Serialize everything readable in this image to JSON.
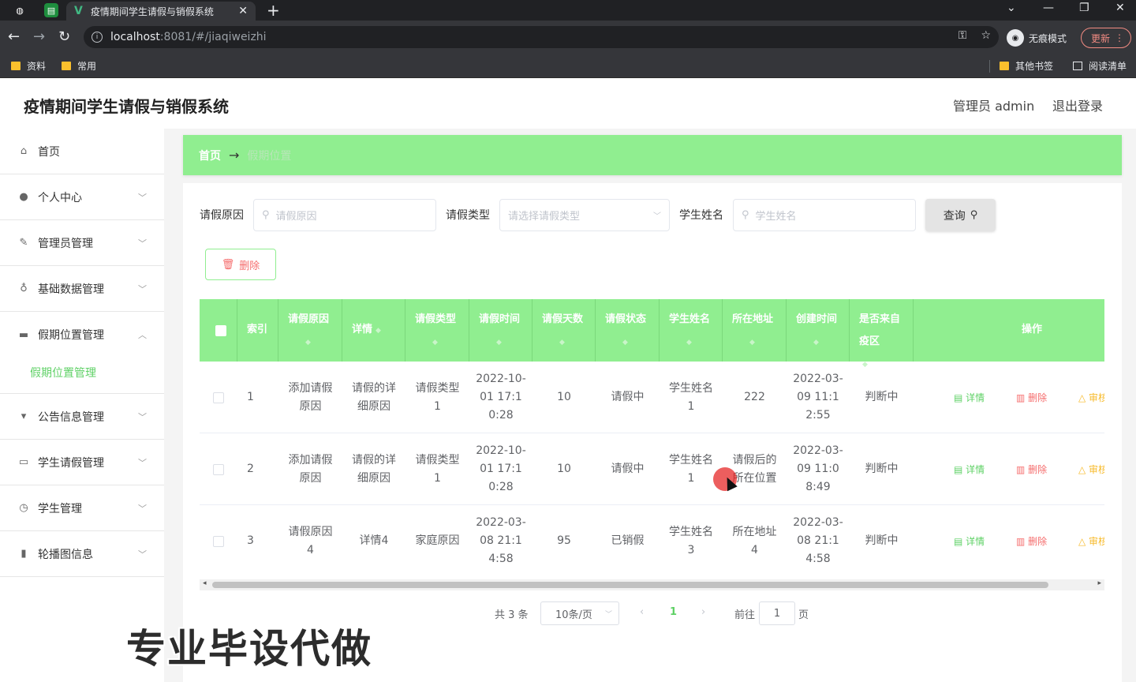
{
  "browser": {
    "tab_title": "疫情期间学生请假与销假系统",
    "url_host": "localhost",
    "url_path": ":8081/#/jiaqiweizhi",
    "incognito_label": "无痕模式",
    "update_label": "更新",
    "bookmarks": [
      "资料",
      "常用"
    ],
    "other_bookmarks": "其他书签",
    "reading_list": "阅读清单"
  },
  "header": {
    "title": "疫情期间学生请假与销假系统",
    "user": "管理员 admin",
    "logout": "退出登录"
  },
  "sidebar": {
    "items": [
      {
        "label": "首页",
        "icon": "home-icon"
      },
      {
        "label": "个人中心",
        "icon": "user-icon"
      },
      {
        "label": "管理员管理",
        "icon": "edit-icon"
      },
      {
        "label": "基础数据管理",
        "icon": "microphone-icon"
      },
      {
        "label": "假期位置管理",
        "icon": "chat-icon"
      },
      {
        "label": "公告信息管理",
        "icon": "notice-icon"
      },
      {
        "label": "学生请假管理",
        "icon": "message-icon"
      },
      {
        "label": "学生管理",
        "icon": "clock-icon"
      },
      {
        "label": "轮播图信息",
        "icon": "chart-icon"
      }
    ],
    "active_sub": "假期位置管理"
  },
  "breadcrumb": {
    "home": "首页",
    "current": "假期位置"
  },
  "filters": {
    "reason_label": "请假原因",
    "reason_placeholder": "请假原因",
    "type_label": "请假类型",
    "type_placeholder": "请选择请假类型",
    "name_label": "学生姓名",
    "name_placeholder": "学生姓名",
    "query_label": "查询",
    "delete_label": "删除"
  },
  "table": {
    "headers": [
      "索引",
      "请假原因",
      "详情",
      "请假类型",
      "请假时间",
      "请假天数",
      "请假状态",
      "学生姓名",
      "所在地址",
      "创建时间",
      "是否来自疫区",
      "操作"
    ],
    "rows": [
      {
        "index": "1",
        "reason": "添加请假原因",
        "detail": "请假的详细原因",
        "type": "请假类型1",
        "time": "2022-10-01 17:10:28",
        "days": "10",
        "status": "请假中",
        "name": "学生姓名1",
        "address": "222",
        "created": "2022-03-09 11:12:55",
        "epidemic": "判断中"
      },
      {
        "index": "2",
        "reason": "添加请假原因",
        "detail": "请假的详细原因",
        "type": "请假类型1",
        "time": "2022-10-01 17:10:28",
        "days": "10",
        "status": "请假中",
        "name": "学生姓名1",
        "address": "请假后的所在位置",
        "created": "2022-03-09 11:08:49",
        "epidemic": "判断中"
      },
      {
        "index": "3",
        "reason": "请假原因4",
        "detail": "详情4",
        "type": "家庭原因",
        "time": "2022-03-08 21:14:58",
        "days": "95",
        "status": "已销假",
        "name": "学生姓名3",
        "address": "所在地址4",
        "created": "2022-03-08 21:14:58",
        "epidemic": "判断中"
      }
    ],
    "actions": {
      "detail": "详情",
      "delete": "删除",
      "audit": "审核"
    }
  },
  "pager": {
    "total": "共 3 条",
    "size": "10条/页",
    "current": "1",
    "goto": "前往",
    "goto_value": "1",
    "page_suffix": "页"
  },
  "watermark": "专业毕设代做",
  "colors": {
    "accent_green": "#90ee90",
    "active_text": "#5fd166",
    "danger": "#f56c6c",
    "warning": "#f7ba2a"
  }
}
